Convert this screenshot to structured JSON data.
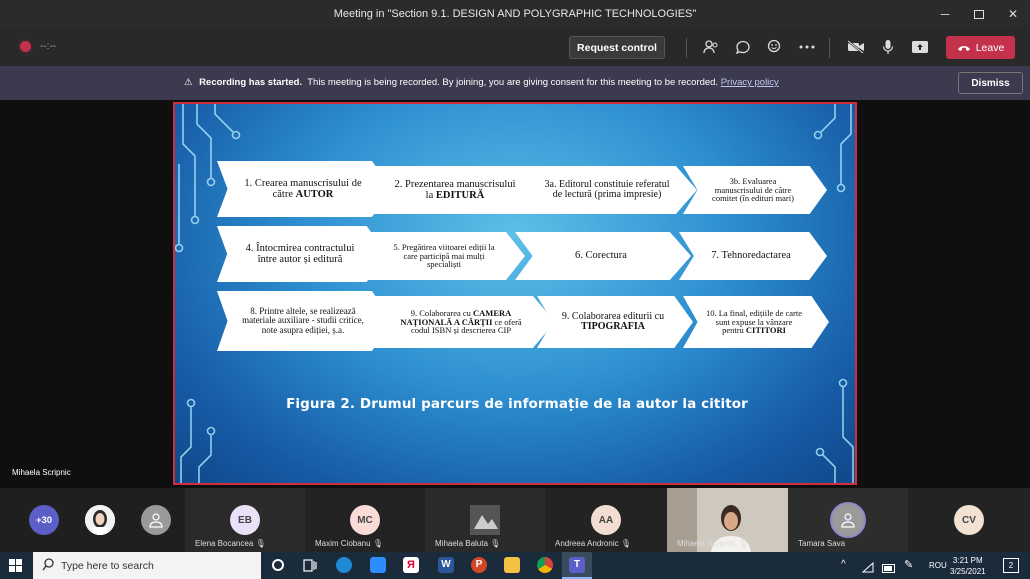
{
  "window": {
    "title": "Meeting in \"Section 9.1. DESIGN AND POLYGRAPHIC TECHNOLOGIES\""
  },
  "toolbar": {
    "timer": "--:--",
    "request_control": "Request control",
    "leave": "Leave"
  },
  "banner": {
    "bold": "Recording has started.",
    "text": "This meeting is being recorded. By joining, you are giving consent for this meeting to be recorded.",
    "link": "Privacy policy",
    "dismiss": "Dismiss"
  },
  "slide": {
    "row1": [
      {
        "pre": "1. Crearea manuscrisului de către ",
        "bold": "AUTOR",
        "post": ""
      },
      {
        "pre": "2. Prezentarea manuscrisului la ",
        "bold": "EDITURĂ",
        "post": ""
      },
      {
        "pre": "3a. Editorul constituie referatul de lectură (prima impresie)",
        "bold": "",
        "post": ""
      },
      {
        "pre": "3b. Evaluarea manuscrisului de către comitet (în edituri mari)",
        "bold": "",
        "post": ""
      }
    ],
    "row2": [
      {
        "pre": "4. Întocmirea contractului între autor și editură",
        "bold": "",
        "post": ""
      },
      {
        "pre": "5. Pregătirea viitoarei ediții la care participă mai mulți specialiști",
        "bold": "",
        "post": ""
      },
      {
        "pre": "6. Corectura",
        "bold": "",
        "post": ""
      },
      {
        "pre": "7. Tehnoredactarea",
        "bold": "",
        "post": ""
      }
    ],
    "row3": [
      {
        "pre": "8. Printre altele, se realizează materiale auxiliare - studii critice, note asupra ediției, ș.a.",
        "bold": "",
        "post": ""
      },
      {
        "pre": "9. Colaborarea cu ",
        "bold": "CAMERA NAȚIONALĂ A CĂRȚII",
        "post": " ce oferă codul ISBN și descrierea CIP"
      },
      {
        "pre": "9. Colaborarea editurii cu ",
        "bold": "TIPOGRAFIA",
        "post": ""
      },
      {
        "pre": "10. La final, edițiile de carte sunt expuse la vânzare pentru ",
        "bold": "CITITORI",
        "post": ""
      }
    ],
    "caption": "Figura 2. Drumul parcurs de informație de la autor la cititor"
  },
  "presenter": "Mihaela Scripnic",
  "participants": {
    "overflow": "+30",
    "tiles": [
      {
        "initials": "EB",
        "name": "Elena Bocancea",
        "color": "#e8e1f7"
      },
      {
        "initials": "MC",
        "name": "Maxim Ciobanu",
        "color": "#f9dcd6"
      },
      {
        "initials": "",
        "name": "Mihaela Baluta",
        "color": "#888888"
      },
      {
        "initials": "AA",
        "name": "Andreea Andronic",
        "color": "#f3ddd0"
      },
      {
        "initials": "",
        "name": "Mihaela Scripnic",
        "color": "#666666"
      },
      {
        "initials": "",
        "name": "Tamara Sava",
        "color": "#9a9a9a"
      },
      {
        "initials": "CV",
        "name": "",
        "color": "#f1e2d3"
      }
    ]
  },
  "taskbar": {
    "search_placeholder": "Type here to search",
    "lang": "ROU",
    "time": "3:21 PM",
    "date": "3/25/2021",
    "notif_count": "2"
  }
}
